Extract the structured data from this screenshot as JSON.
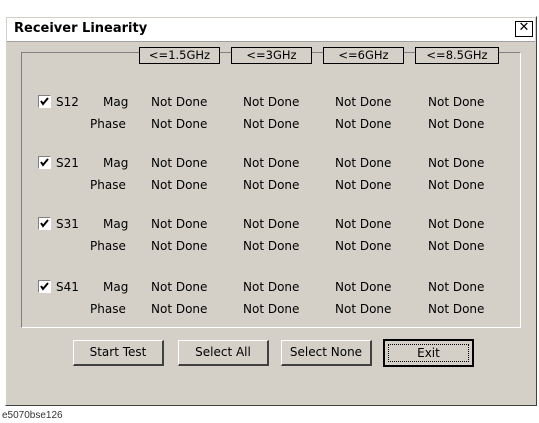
{
  "window": {
    "title": "Receiver Linearity",
    "close_glyph": "✕"
  },
  "frequency_headers": [
    "<=1.5GHz",
    "<=3GHz",
    "<=6GHz",
    "<=8.5GHz"
  ],
  "params": [
    {
      "name": "S12",
      "checked": true,
      "mag_label": "Mag",
      "phase_label": "Phase",
      "mag": [
        "Not Done",
        "Not Done",
        "Not Done",
        "Not Done"
      ],
      "phase": [
        "Not Done",
        "Not Done",
        "Not Done",
        "Not Done"
      ]
    },
    {
      "name": "S21",
      "checked": true,
      "mag_label": "Mag",
      "phase_label": "Phase",
      "mag": [
        "Not Done",
        "Not Done",
        "Not Done",
        "Not Done"
      ],
      "phase": [
        "Not Done",
        "Not Done",
        "Not Done",
        "Not Done"
      ]
    },
    {
      "name": "S31",
      "checked": true,
      "mag_label": "Mag",
      "phase_label": "Phase",
      "mag": [
        "Not Done",
        "Not Done",
        "Not Done",
        "Not Done"
      ],
      "phase": [
        "Not Done",
        "Not Done",
        "Not Done",
        "Not Done"
      ]
    },
    {
      "name": "S41",
      "checked": true,
      "mag_label": "Mag",
      "phase_label": "Phase",
      "mag": [
        "Not Done",
        "Not Done",
        "Not Done",
        "Not Done"
      ],
      "phase": [
        "Not Done",
        "Not Done",
        "Not Done",
        "Not Done"
      ]
    }
  ],
  "buttons": {
    "start_test": "Start Test",
    "select_all": "Select All",
    "select_none": "Select None",
    "exit": "Exit"
  },
  "caption": "e5070bse126"
}
